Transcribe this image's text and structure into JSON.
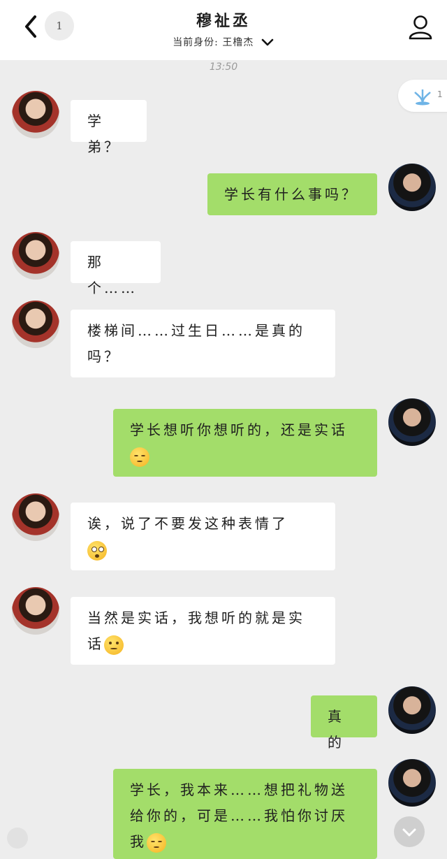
{
  "header": {
    "unread_count": "1",
    "title": "穆祉丞",
    "identity_label": "当前身份: 王橹杰"
  },
  "timestamp": "13:50",
  "side_pill": {
    "count": "1",
    "icon": "fountain-icon"
  },
  "messages": [
    {
      "side": "in",
      "text": "学弟？"
    },
    {
      "side": "out",
      "text": "学长有什么事吗？"
    },
    {
      "side": "in",
      "text": "那个……"
    },
    {
      "side": "in",
      "text": "楼梯间……过生日……是真的",
      "text2": "吗？"
    },
    {
      "side": "out",
      "text": "学长想听你想听的，还是实话",
      "emoji": "pensive-face-emoji"
    },
    {
      "side": "in",
      "text": "诶，说了不要发这种表情了",
      "emoji": "flushed-face-emoji"
    },
    {
      "side": "in",
      "text": "当然是实话，我想听的就是实",
      "text2": "话",
      "emoji": "thinking-face-emoji"
    },
    {
      "side": "out",
      "text": "真的"
    },
    {
      "side": "out",
      "text": "学长，我本来……想把礼物送",
      "text2": "给你的，可是……我怕你讨厌",
      "text3": "我",
      "emoji": "pensive-face-emoji"
    }
  ],
  "colors": {
    "incoming": "#ffffff",
    "outgoing": "#a3dd6a",
    "background": "#ededed"
  }
}
